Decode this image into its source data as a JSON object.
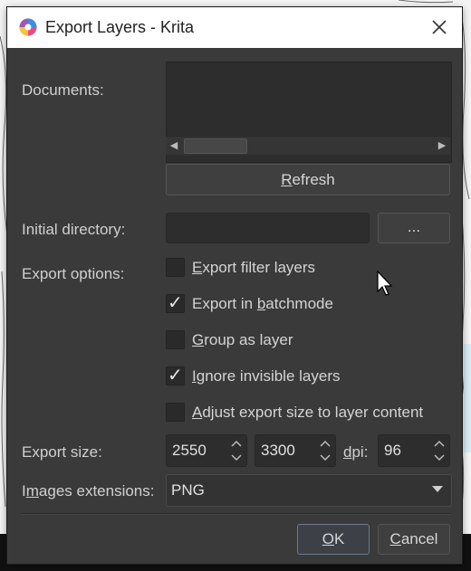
{
  "window": {
    "title": "Export Layers - Krita",
    "icons": {
      "app": "krita-icon",
      "close": "close-icon"
    }
  },
  "documents": {
    "label_pre": "Documents:",
    "scroll_left": "◀",
    "scroll_right": "▶"
  },
  "refresh": {
    "label_pre": "",
    "label_ul": "R",
    "label_post": "efresh"
  },
  "initial_directory": {
    "label": "Initial directory:",
    "value": "",
    "browse_label": "..."
  },
  "export_options": {
    "label": "Export options:",
    "items": [
      {
        "ul": "E",
        "rest": "xport filter layers",
        "checked": false,
        "pre": ""
      },
      {
        "pre": "Export in ",
        "ul": "b",
        "rest": "atchmode",
        "checked": true
      },
      {
        "ul": "G",
        "rest": "roup as layer",
        "checked": false,
        "pre": ""
      },
      {
        "ul": "I",
        "rest": "gnore invisible layers",
        "checked": true,
        "pre": ""
      },
      {
        "ul": "A",
        "rest": "djust export size to layer content",
        "checked": false,
        "pre": ""
      }
    ],
    "check_glyph": "✓"
  },
  "export_size": {
    "label": "Export size:",
    "width": "2550",
    "height": "3300",
    "dpi_label_ul": "d",
    "dpi_label_rest": "pi:",
    "dpi": "96"
  },
  "images_extensions": {
    "label_pre": "I",
    "label_ul": "m",
    "label_post": "ages extensions:",
    "selected": "PNG"
  },
  "buttons": {
    "ok_ul": "O",
    "ok_rest": "K",
    "cancel_ul": "C",
    "cancel_rest": "ancel"
  },
  "colors": {
    "dialog_bg": "#3a3a3a",
    "field_bg": "#2d2d2d",
    "titlebar_bg": "#ffffff",
    "text": "#d4d4d4"
  }
}
